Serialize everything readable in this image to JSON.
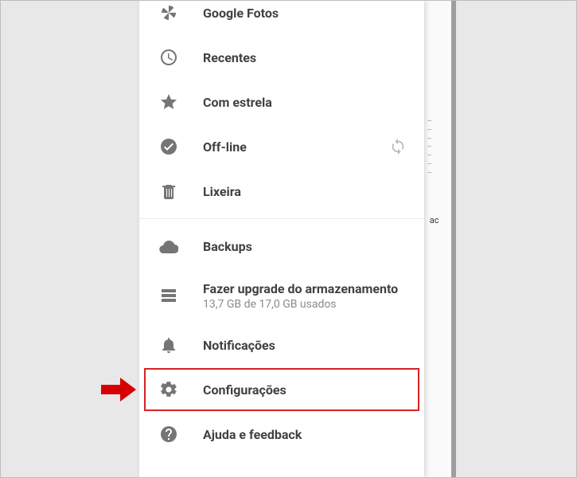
{
  "drawer": {
    "items": [
      {
        "icon": "pinwheel",
        "label": "Google Fotos"
      },
      {
        "icon": "clock",
        "label": "Recentes"
      },
      {
        "icon": "star",
        "label": "Com estrela"
      },
      {
        "icon": "offline",
        "label": "Off-line",
        "trailing": "sync"
      },
      {
        "icon": "trash",
        "label": "Lixeira"
      }
    ],
    "items2": [
      {
        "icon": "cloud",
        "label": "Backups"
      },
      {
        "icon": "storage",
        "label": "Fazer upgrade do armazenamento",
        "sub": "13,7 GB de 17,0 GB usados"
      },
      {
        "icon": "bell",
        "label": "Notificações"
      },
      {
        "icon": "gear",
        "label": "Configurações"
      },
      {
        "icon": "help",
        "label": "Ajuda e feedback"
      }
    ]
  },
  "highlight_index": 3,
  "background_hint_1": "…\n…\n…\n…\n…\n…\n…",
  "background_hint_2": " ac\n  "
}
